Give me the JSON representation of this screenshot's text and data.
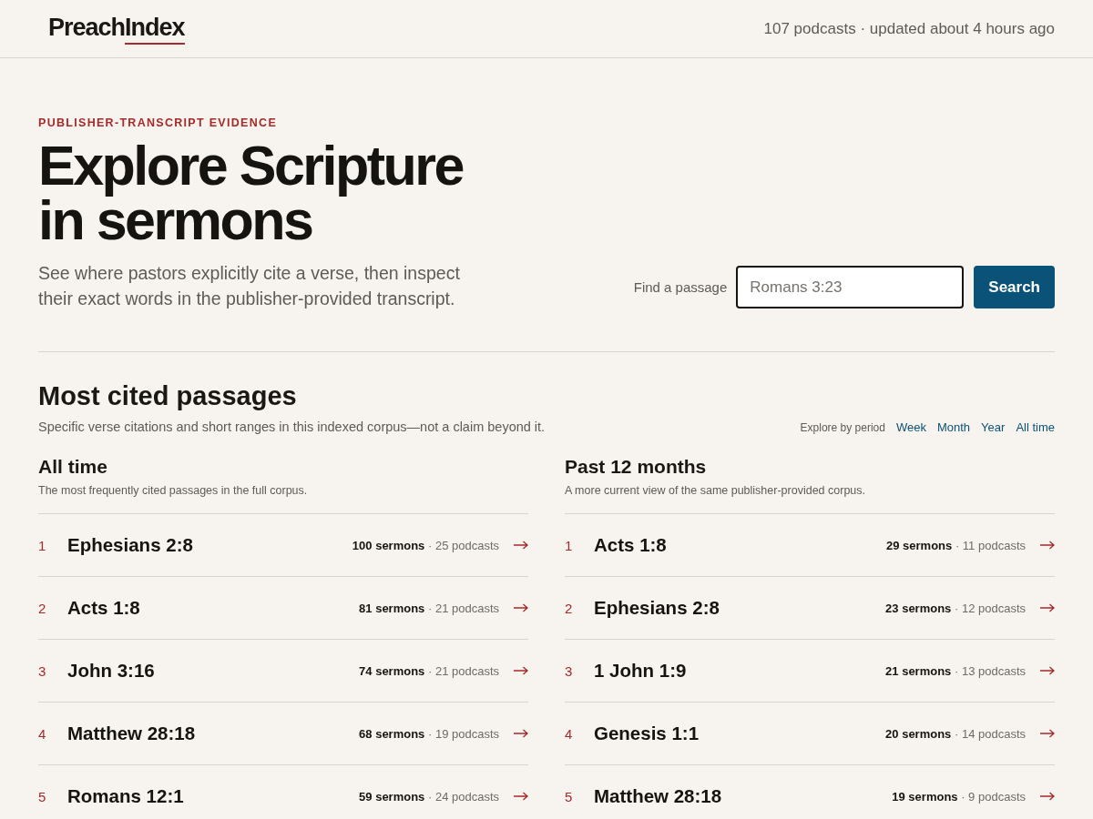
{
  "header": {
    "logo_parts": [
      "Preach",
      "Index"
    ],
    "status": "107 podcasts · updated about 4 hours ago"
  },
  "hero": {
    "eyebrow": "PUBLISHER-TRANSCRIPT EVIDENCE",
    "title_lines": [
      "Explore Scripture",
      "in sermons"
    ],
    "subtitle": "See where pastors explicitly cite a verse, then inspect their exact words in the publisher-provided transcript.",
    "search": {
      "label": "Find a passage",
      "placeholder": "Romans 3:23",
      "button": "Search"
    }
  },
  "section": {
    "title": "Most cited passages",
    "note": "Specific verse citations and short ranges in this indexed corpus—not a claim beyond it.",
    "period_label": "Explore by period",
    "periods": [
      "Week",
      "Month",
      "Year",
      "All time"
    ]
  },
  "lists": [
    {
      "title": "All time",
      "subtitle": "The most frequently cited passages in the full corpus.",
      "rows": [
        {
          "rank": "1",
          "passage": "Ephesians 2:8",
          "stats": "**100 sermons** · 25 podcasts"
        },
        {
          "rank": "2",
          "passage": "Acts 1:8",
          "stats": "**81 sermons** · 21 podcasts"
        },
        {
          "rank": "3",
          "passage": "John 3:16",
          "stats": "**74 sermons** · 21 podcasts"
        },
        {
          "rank": "4",
          "passage": "Matthew 28:18",
          "stats": "**68 sermons** · 19 podcasts"
        },
        {
          "rank": "5",
          "passage": "Romans 12:1",
          "stats": "**59 sermons** · 24 podcasts"
        }
      ]
    },
    {
      "title": "Past 12 months",
      "subtitle": "A more current view of the same publisher-provided corpus.",
      "rows": [
        {
          "rank": "1",
          "passage": "Acts 1:8",
          "stats": "**29 sermons** · 11 podcasts"
        },
        {
          "rank": "2",
          "passage": "Ephesians 2:8",
          "stats": "**23 sermons** · 12 podcasts"
        },
        {
          "rank": "3",
          "passage": "1 John 1:9",
          "stats": "**21 sermons** · 13 podcasts"
        },
        {
          "rank": "4",
          "passage": "Genesis 1:1",
          "stats": "**20 sermons** · 14 podcasts"
        },
        {
          "rank": "5",
          "passage": "Matthew 28:18",
          "stats": "**19 sermons** · 9 podcasts"
        }
      ]
    }
  ]
}
